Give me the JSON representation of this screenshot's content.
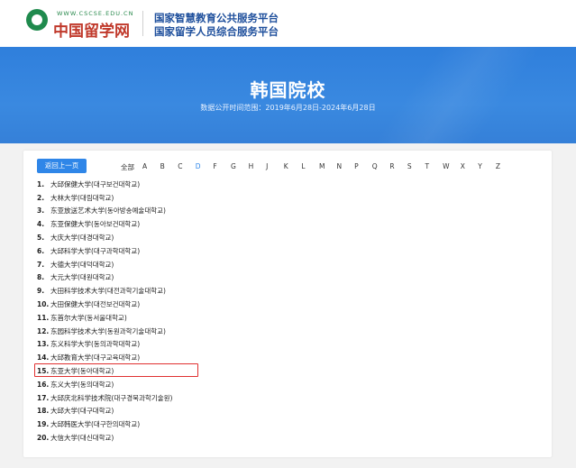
{
  "header": {
    "logo_url_text": "WWW.CSCSE.EDU.CN",
    "logo_cn_text": "中国留学网",
    "title_line1": "国家智慧教育公共服务平台",
    "title_line2": "国家留学人员综合服务平台"
  },
  "banner": {
    "title": "韩国院校",
    "subtitle": "数据公开时间范围：2019年6月28日-2024年6月28日"
  },
  "toolbar": {
    "back_label": "返回上一页"
  },
  "letters": {
    "all": "全部",
    "items": [
      "A",
      "B",
      "C",
      "D",
      "F",
      "G",
      "H",
      "J",
      "K",
      "L",
      "M",
      "N",
      "P",
      "Q",
      "R",
      "S",
      "T",
      "W",
      "X",
      "Y",
      "Z"
    ],
    "active": "D",
    "active_color": "#2f86e8"
  },
  "schools": [
    {
      "num": "1.",
      "name": "大邱保健大学(대구보건대학교)"
    },
    {
      "num": "2.",
      "name": "大林大学(대림대학교)"
    },
    {
      "num": "3.",
      "name": "东亚放送艺术大学(동아방송예술대학교)"
    },
    {
      "num": "4.",
      "name": "东亚保健大学(동아보건대학교)"
    },
    {
      "num": "5.",
      "name": "大庆大学(대경대학교)"
    },
    {
      "num": "6.",
      "name": "大邱科学大学(대구과학대학교)"
    },
    {
      "num": "7.",
      "name": "大德大学(대덕대학교)"
    },
    {
      "num": "8.",
      "name": "大元大学(대원대학교)"
    },
    {
      "num": "9.",
      "name": "大田科学技术大学(대전과학기술대학교)"
    },
    {
      "num": "10.",
      "name": "大田保健大学(대전보건대학교)"
    },
    {
      "num": "11.",
      "name": "东首尔大学(동서울대학교)"
    },
    {
      "num": "12.",
      "name": "东园科学技术大学(동원과학기술대학교)"
    },
    {
      "num": "13.",
      "name": "东义科学大学(동의과학대학교)"
    },
    {
      "num": "14.",
      "name": "大邱教育大学(대구교육대학교)"
    },
    {
      "num": "15.",
      "name": "东亚大学(동아대학교)"
    },
    {
      "num": "16.",
      "name": "东义大学(동의대학교)"
    },
    {
      "num": "17.",
      "name": "大邱庆北科学技术院(대구경북과학기술원)"
    },
    {
      "num": "18.",
      "name": "大邱大学(대구대학교)"
    },
    {
      "num": "19.",
      "name": "大邱韩医大学(대구한의대학교)"
    },
    {
      "num": "20.",
      "name": "大信大学(대신대학교)"
    }
  ],
  "highlight": {
    "row_index": 14,
    "color": "#e03030"
  }
}
